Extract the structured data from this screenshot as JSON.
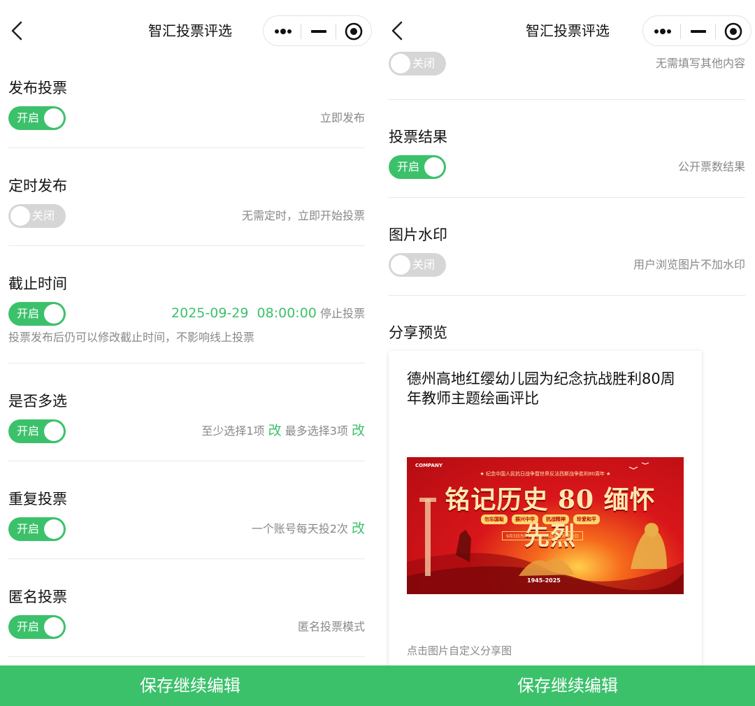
{
  "left": {
    "nav_title": "智汇投票评选",
    "sections": [
      {
        "title": "发布投票",
        "toggle": "开启",
        "on": true,
        "note": "立即发布"
      },
      {
        "title": "定时发布",
        "toggle": "关闭",
        "on": false,
        "note": "无需定时，立即开始投票"
      },
      {
        "title": "截止时间",
        "toggle": "开启",
        "on": true,
        "deadline": "2025-09-29  08:00:00",
        "note": "停止投票",
        "sub_note": "投票发布后仍可以修改截止时间，不影响线上投票"
      },
      {
        "title": "是否多选",
        "toggle": "开启",
        "on": true,
        "note_min": "至少选择1项",
        "note_max": "最多选择3项",
        "change": "改"
      },
      {
        "title": "重复投票",
        "toggle": "开启",
        "on": true,
        "note": "一个账号每天投2次",
        "change": "改"
      },
      {
        "title": "匿名投票",
        "toggle": "开启",
        "on": true,
        "note": "匿名投票模式"
      }
    ],
    "save_label": "保存继续编辑"
  },
  "right": {
    "nav_title": "智汇投票评选",
    "top_item": {
      "toggle": "关闭",
      "on": false,
      "note": "无需填写其他内容"
    },
    "sections": [
      {
        "title": "投票结果",
        "toggle": "开启",
        "on": true,
        "note": "公开票数结果"
      },
      {
        "title": "图片水印",
        "toggle": "关闭",
        "on": false,
        "note": "用户浏览图片不加水印"
      }
    ],
    "share_preview": {
      "title": "分享预览",
      "card_title": "德州高地红缨幼儿园为纪念抗战胜利80周年教师主题绘画评比",
      "poster": {
        "company": "COMPANY",
        "top_line": "★ 纪念中国人民抗日战争暨世界反法西斯战争胜利80周年 ★",
        "headline": "铭记历史 80 缅怀先烈",
        "pills": [
          "勿忘国耻",
          "振兴中华",
          "抗战精神",
          "珍爱和平"
        ],
        "banner": "9月3日为中国人民抗日战争胜利纪念日",
        "years": "1945-2025"
      },
      "hint": "点击图片自定义分享图"
    },
    "save_label": "保存继续编辑"
  },
  "colors": {
    "accent": "#3cc16b",
    "toggle_off": "#d6d6d6",
    "poster_red": "#d9161a"
  }
}
